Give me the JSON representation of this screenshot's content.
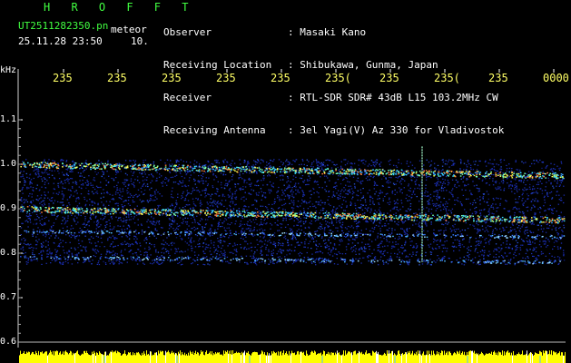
{
  "header": {
    "title": "H R O F F T",
    "filename": "UT2511282350.pn",
    "meteor_label": "meteor",
    "datetime": "25.11.28 23:50",
    "count": "10."
  },
  "meta": [
    {
      "key": "Observer",
      "value": ": Masaki Kano"
    },
    {
      "key": "Receiving Location",
      "value": ": Shibukawa, Gunma, Japan"
    },
    {
      "key": "Receiver",
      "value": ": RTL-SDR SDR# 43dB L15 103.2MHz CW"
    },
    {
      "key": "Receiving Antenna",
      "value": ": 3el Yagi(V) Az 330 for Vladivostok"
    }
  ],
  "axes": {
    "y_unit": "kHz",
    "y_ticks": [
      "1.1",
      "1.0",
      "0.9",
      "0.8",
      "0.7",
      "0.6"
    ],
    "x_ticks": [
      "235",
      "235",
      "235",
      "235",
      "235",
      "235(",
      "235",
      "235(",
      "235",
      "0000"
    ]
  },
  "colors": {
    "background": "#000000",
    "header_green": "#41ff41",
    "tick_yellow": "#ffff66",
    "noise_blue": "#1a2ab8",
    "spectrum_yellow": "#ffff00"
  },
  "bands": [
    {
      "name": "band-1.0",
      "freq_start": 1.0,
      "freq_end": 0.975
    },
    {
      "name": "band-0.9",
      "freq_start": 0.9,
      "freq_end": 0.875
    },
    {
      "name": "band-0.85",
      "freq_start": 0.85,
      "freq_end": 0.837
    },
    {
      "name": "band-0.79",
      "freq_start": 0.792,
      "freq_end": 0.78
    }
  ]
}
